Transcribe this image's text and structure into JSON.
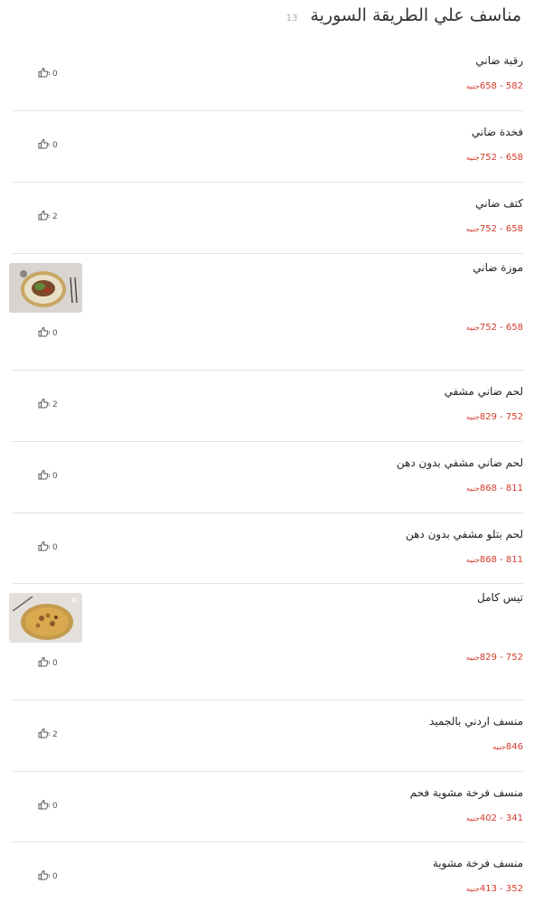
{
  "header": {
    "title": "مناسف علي الطريقة السورية",
    "count": "13"
  },
  "items": [
    {
      "name": "رقبة ضاني",
      "price": "582 - 658",
      "currency": "جنيه",
      "likes": "0",
      "has_image": false
    },
    {
      "name": "فخدة ضاني",
      "price": "658 - 752",
      "currency": "جنيه",
      "likes": "0",
      "has_image": false
    },
    {
      "name": "كتف ضاني",
      "price": "658 - 752",
      "currency": "جنيه",
      "likes": "2",
      "has_image": false
    },
    {
      "name": "موزة ضاني",
      "price": "658 - 752",
      "currency": "جنيه",
      "likes": "0",
      "has_image": true
    },
    {
      "name": "لحم ضاني مشفي",
      "price": "752 - 829",
      "currency": "جنيه",
      "likes": "2",
      "has_image": false
    },
    {
      "name": "لحم ضاني مشفي بدون دهن",
      "price": "811 - 868",
      "currency": "جنيه",
      "likes": "0",
      "has_image": false
    },
    {
      "name": "لحم بتلو مشفي بدون دهن",
      "price": "811 - 868",
      "currency": "جنيه",
      "likes": "0",
      "has_image": false
    },
    {
      "name": "تيس كامل",
      "price": "752 - 829",
      "currency": "جنيه",
      "likes": "0",
      "has_image": true
    },
    {
      "name": "منسف اردني بالجميد",
      "price": "846",
      "currency": "جنيه",
      "likes": "2",
      "has_image": false
    },
    {
      "name": "منسف فرخة مشوية فحم",
      "price": "341 - 402",
      "currency": "جنيه",
      "likes": "0",
      "has_image": false
    },
    {
      "name": "منسف فرخة مشوية",
      "price": "352 - 413",
      "currency": "جنيه",
      "likes": "0",
      "has_image": false
    }
  ],
  "colors": {
    "price": "#d33a2c",
    "divider": "#e2e2e2",
    "title": "#333333"
  },
  "icons": {
    "likes": "thumbs-up-icon"
  }
}
